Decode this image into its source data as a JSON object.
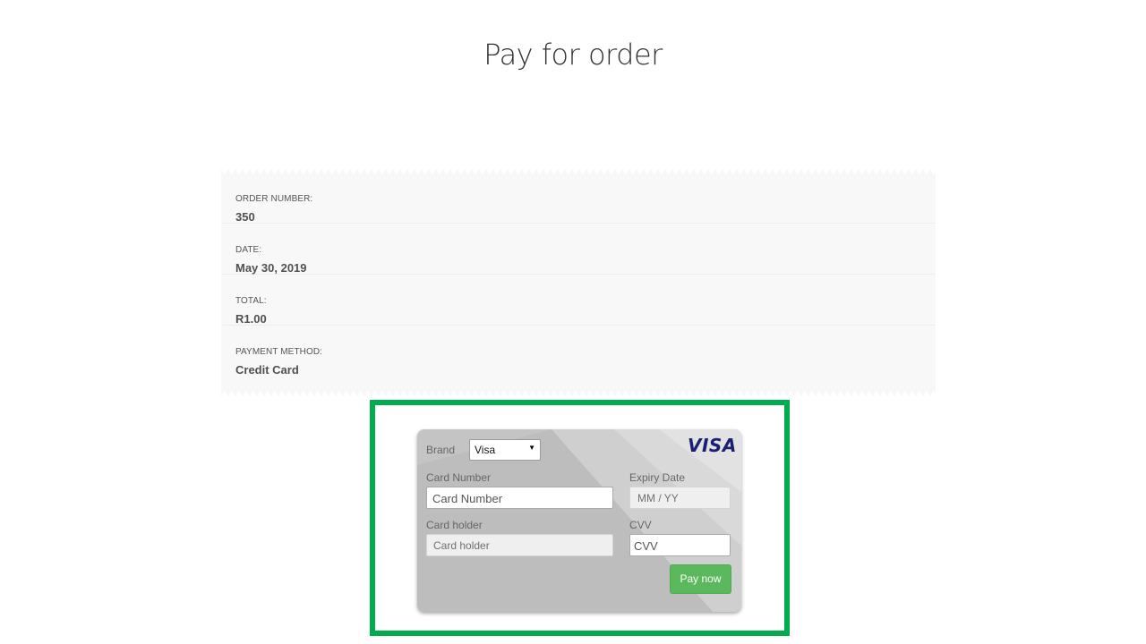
{
  "page": {
    "title": "Pay for order"
  },
  "order": {
    "rows": [
      {
        "label": "ORDER NUMBER:",
        "value": "350"
      },
      {
        "label": "DATE:",
        "value": "May 30, 2019"
      },
      {
        "label": "TOTAL:",
        "value": "R1.00"
      },
      {
        "label": "PAYMENT METHOD:",
        "value": "Credit Card"
      }
    ]
  },
  "card_form": {
    "brand_label": "Brand",
    "brand_selected": "Visa",
    "logo_text": "VISA",
    "card_number_label": "Card Number",
    "card_number_placeholder": "Card Number",
    "expiry_label": "Expiry Date",
    "expiry_placeholder": "MM / YY",
    "holder_label": "Card holder",
    "holder_placeholder": "Card holder",
    "cvv_label": "CVV",
    "cvv_placeholder": "CVV",
    "pay_button": "Pay now"
  },
  "colors": {
    "highlight": "#00ac4e",
    "pay_button": "#5cb85c",
    "visa_blue": "#1a1f71",
    "card_background": "#bdbdbd"
  }
}
